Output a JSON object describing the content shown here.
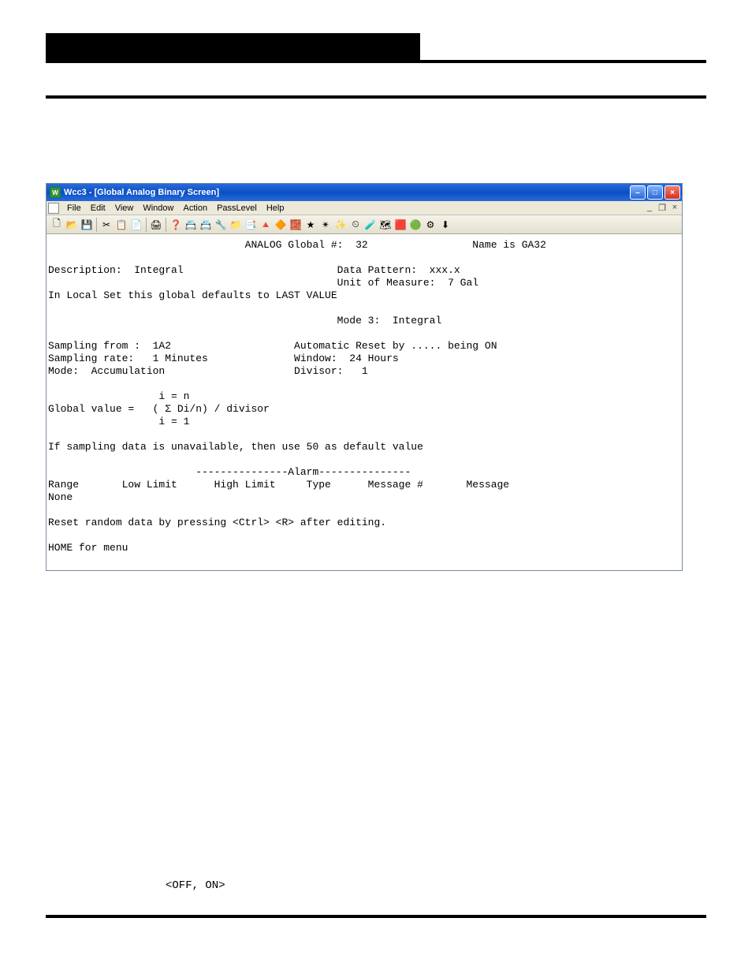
{
  "window": {
    "title": "Wcc3 - [Global Analog Binary Screen]",
    "minimize": "–",
    "maximize": "□",
    "close": "×"
  },
  "menu": {
    "file": "File",
    "edit": "Edit",
    "view": "View",
    "window": "Window",
    "action": "Action",
    "passlevel": "PassLevel",
    "help": "Help",
    "mdi_min": "_",
    "mdi_restore": "❐",
    "mdi_close": "×"
  },
  "toolbar_icons": [
    "🗋",
    "📂",
    "💾",
    "|",
    "✂",
    "📋",
    "📄",
    "|",
    "🖨",
    "|",
    "❓",
    "📇",
    "📇",
    "🔧",
    "📁",
    "📑",
    "🔺",
    "🔶",
    "🧱",
    "★",
    "✴",
    "✨",
    "⏲",
    "🧪",
    "🗺",
    "🟥",
    "🟢",
    "⚙",
    "⬇"
  ],
  "content_lines": [
    "                                ANALOG Global #:  32                 Name is GA32",
    "",
    "Description:  Integral                         Data Pattern:  xxx.x",
    "                                               Unit of Measure:  7 Gal",
    "In Local Set this global defaults to LAST VALUE",
    "",
    "                                               Mode 3:  Integral",
    "",
    "Sampling from :  1A2                    Automatic Reset by ..... being ON",
    "Sampling rate:   1 Minutes              Window:  24 Hours",
    "Mode:  Accumulation                     Divisor:   1",
    "",
    "                  i = n",
    "Global value =   ( Σ Di/n) / divisor",
    "                  i = 1",
    "",
    "If sampling data is unavailable, then use 50 as default value",
    "",
    "                        ---------------Alarm---------------",
    "Range       Low Limit      High Limit     Type      Message #       Message",
    "None",
    "",
    "Reset random data by pressing <Ctrl> <R> after editing.",
    "",
    "HOME for menu",
    ""
  ],
  "below_note": "<OFF, ON>",
  "page_number": ""
}
